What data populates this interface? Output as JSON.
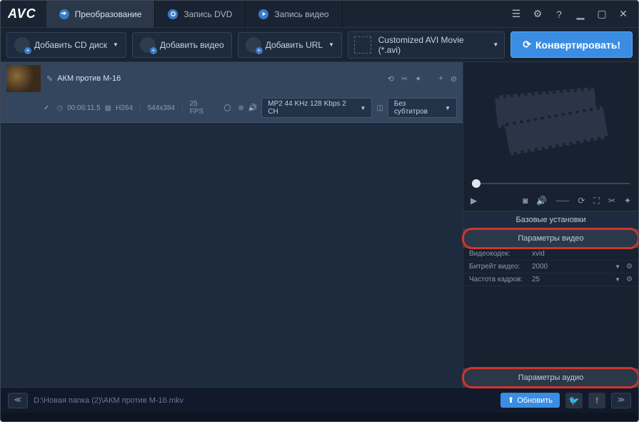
{
  "logo": "AVC",
  "tabs": [
    {
      "label": "Преобразование"
    },
    {
      "label": "Запись DVD"
    },
    {
      "label": "Запись видео"
    }
  ],
  "toolbar": {
    "add_cd": "Добавить CD диск",
    "add_video": "Добавить видео",
    "add_url": "Добавить URL",
    "format": "Customized AVI Movie (*.avi)",
    "convert": "Конвертировать!"
  },
  "item": {
    "title": "АКМ против М-16",
    "duration": "00:06:11.5",
    "codec": "H264",
    "resolution": "544x384",
    "fps": "25 FPS",
    "audio": "MP2 44 KHz 128 Kbps 2 CH",
    "subtitle": "Без субтитров"
  },
  "settings": {
    "basic_header": "Базовые установки",
    "video_header": "Параметры видео",
    "audio_header": "Параметры аудио",
    "codec_label": "Видеокодек:",
    "codec_value": "xvid",
    "bitrate_label": "Битрейт видео:",
    "bitrate_value": "2000",
    "framerate_label": "Частота кадров:",
    "framerate_value": "25"
  },
  "status": {
    "path": "D:\\Новая папка (2)\\АКМ против М-16.mkv",
    "update": "Обновить"
  }
}
